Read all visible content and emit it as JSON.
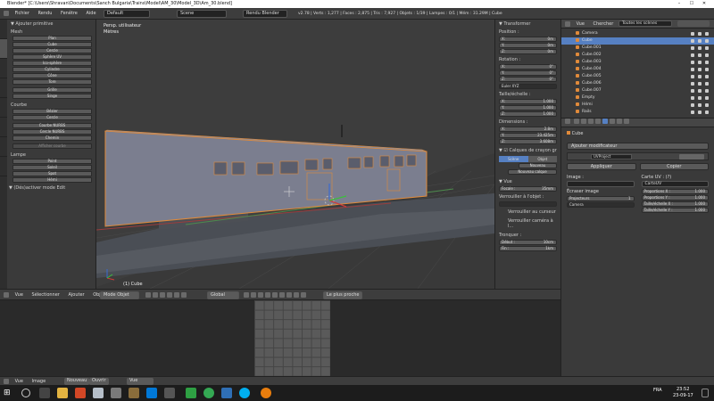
{
  "window": {
    "title": "Blender* [C:\\Users\\Shravan\\Documents\\Sanch Bulgaria\\Trains\\Model\\AM_30\\Model_3D\\Am_30.blend]"
  },
  "infobar": {
    "menus": [
      "Fichier",
      "Rendu",
      "Fenêtre",
      "Aide"
    ],
    "layout": "Default",
    "scene": "Scene",
    "engine": "Rendu Blender",
    "stats": "v2.78 | Verts : 1,277 | Faces : 2,875 | Tris : 7,927 | Objets : 1/39 | Lampes : 0/1 | Mém : 31.29M | Cube"
  },
  "toolshelf": {
    "header": "▼ Ajouter primitive",
    "sections": [
      {
        "title": "Mesh",
        "items": [
          "Plan",
          "Cube",
          "Cercle",
          "Sphère UV",
          "Ico-sphère",
          "Cylindre",
          "Cône",
          "Tore",
          "Grille",
          "Singe"
        ]
      },
      {
        "title": "Courbe",
        "items": [
          "Bézier",
          "Cercle",
          "Courbe NURBS",
          "Cercle NURBS",
          "Chemin"
        ]
      },
      {
        "title": "",
        "items": [
          "Afficher courbe"
        ]
      },
      {
        "title": "Lampe",
        "items": [
          "Point",
          "Soleil",
          "Spot",
          "Hémi"
        ]
      }
    ],
    "footer": "▼ (Dés)activer mode Edit"
  },
  "viewport": {
    "view_label": "Persp. utilisateur",
    "units_label": "Mètres",
    "object_label": "(1) Cube"
  },
  "npanel": {
    "transform_title": "▼ Transformer",
    "position_label": "Position :",
    "position": [
      {
        "axis": "X:",
        "value": "0m"
      },
      {
        "axis": "Y:",
        "value": "0m"
      },
      {
        "axis": "Z:",
        "value": "0m"
      }
    ],
    "rotation_label": "Rotation :",
    "rotation": [
      {
        "axis": "X:",
        "value": "0°"
      },
      {
        "axis": "Y:",
        "value": "0°"
      },
      {
        "axis": "Z:",
        "value": "0°"
      }
    ],
    "rotation_mode": "Euler XYZ",
    "scale_label": "Taille/échelle :",
    "scale": [
      {
        "axis": "X:",
        "value": "1.000"
      },
      {
        "axis": "Y:",
        "value": "1.000"
      },
      {
        "axis": "Z:",
        "value": "1.000"
      }
    ],
    "dimensions_label": "Dimensions :",
    "dimensions": [
      {
        "axis": "X:",
        "value": "2.8m"
      },
      {
        "axis": "Y:",
        "value": "23.425m"
      },
      {
        "axis": "Z:",
        "value": "3.608m"
      }
    ],
    "grease_title": "▼ ☑ Calques de crayon gr",
    "grease_tabs": [
      "Scène",
      "Objet"
    ],
    "grease_new": "Nouveau",
    "grease_new_layer": "Nouveau calque",
    "view_title": "▼ Vue",
    "focal_label": "Focale :",
    "focal_value": "35mm",
    "lock_label": "Verrouiller à l'objet :",
    "lock_cursor": "Verrouiller au curseur",
    "lock_camera": "Verrouiller caméra à l...",
    "clip_label": "Tronquer :",
    "clip_start_label": "Début :",
    "clip_start": "10cm",
    "clip_end_label": "Fin :",
    "clip_end": "1km"
  },
  "outliner": {
    "menus": [
      "Vue",
      "Chercher"
    ],
    "filter": "Toutes les scènes",
    "items": [
      "Camera",
      "Cube",
      "Cube.001",
      "Cube.002",
      "Cube.003",
      "Cube.004",
      "Cube.005",
      "Cube.006",
      "Cube.007",
      "Empty",
      "Hémi",
      "Rails"
    ]
  },
  "properties": {
    "object_name": "Cube",
    "add_modifier": "Ajouter modificateur",
    "modifier_name": "UVProject",
    "apply": "Appliquer",
    "copy": "Copier",
    "image_label": "Image :",
    "uv_map_label": "Carte UV : (?)",
    "uv_map_value": "CarteUV",
    "override_image": "Écraser image",
    "projectors_label": "Projecteurs",
    "projectors_value": "1",
    "camera_value": "Camera",
    "aspect_x_label": "Proportions X :",
    "aspect_x": "1.000",
    "aspect_y_label": "Proportions Y :",
    "aspect_y": "1.000",
    "scale_x_label": "Taille/échelle X :",
    "scale_x": "1.000",
    "scale_y_label": "Taille/échelle Y :",
    "scale_y": "1.000"
  },
  "view3d_header": {
    "menus": [
      "Vue",
      "Sélectionner",
      "Ajouter",
      "Objet"
    ],
    "mode": "Mode Objet",
    "orientation": "Global",
    "snap": "Le plus proche"
  },
  "uv_header": {
    "menus": [
      "Vue",
      "Image"
    ],
    "new": "Nouveau",
    "open": "Ouvrir",
    "view": "Vue"
  },
  "taskbar": {
    "lang": "FRA",
    "time": "23:52",
    "date": "23-09-17"
  },
  "colors": {
    "selection_orange": "#e08a3a",
    "button_blue": "#5680c2",
    "panel_gray": "#3a3a3a"
  }
}
